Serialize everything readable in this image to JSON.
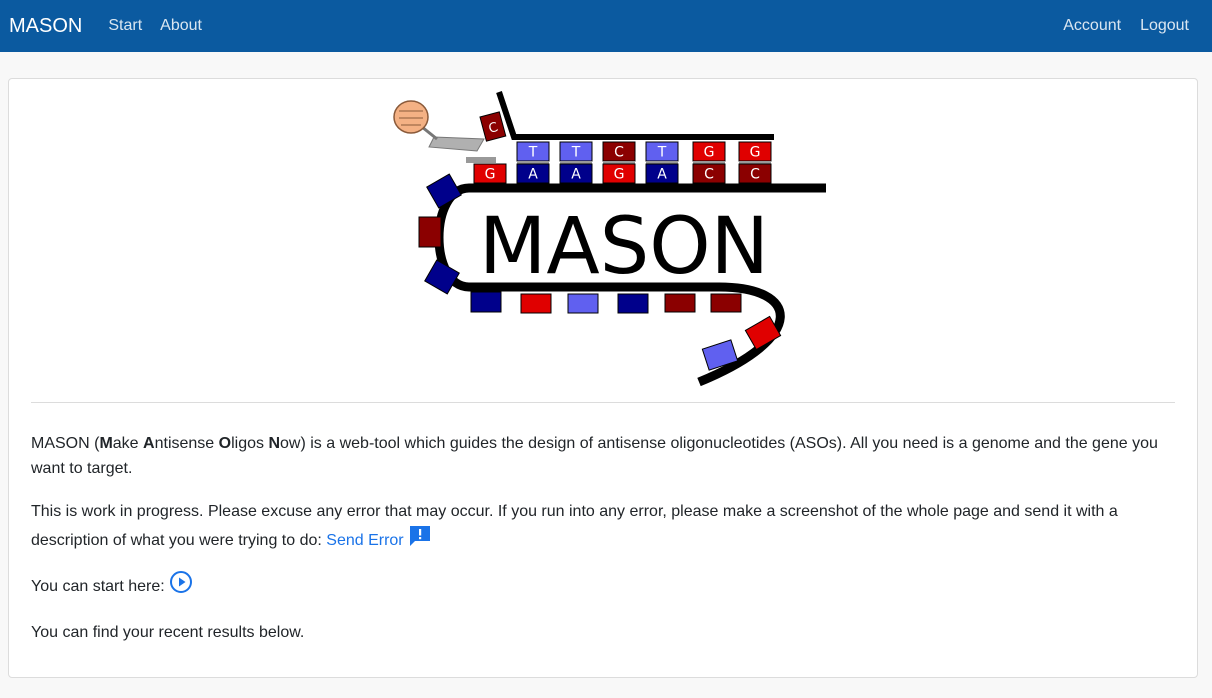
{
  "navbar": {
    "brand": "MASON",
    "left_links": [
      "Start",
      "About"
    ],
    "right_links": [
      "Account",
      "Logout"
    ],
    "color": "#0b5aa0"
  },
  "logo": {
    "title": "MASON",
    "top_strand": [
      "T",
      "T",
      "C",
      "T",
      "G",
      "G"
    ],
    "bottom_strand": [
      "G",
      "A",
      "A",
      "G",
      "A",
      "C",
      "C"
    ],
    "hook_letter": "C"
  },
  "intro": {
    "acronym_parts": [
      {
        "text": "MASON (",
        "bold": false
      },
      {
        "text": "M",
        "bold": true
      },
      {
        "text": "ake ",
        "bold": false
      },
      {
        "text": "A",
        "bold": true
      },
      {
        "text": "ntisense ",
        "bold": false
      },
      {
        "text": "O",
        "bold": true
      },
      {
        "text": "ligos ",
        "bold": false
      },
      {
        "text": "N",
        "bold": true
      },
      {
        "text": "ow) is a web-tool which guides the design of antisense oligonucleotides (ASOs). All you need is a genome and the gene you want to target.",
        "bold": false
      }
    ],
    "wip_text": "This is work in progress. Please excuse any error that may occur. If you run into any error, please make a screenshot of the whole page and send it with a description of what you were trying to do: ",
    "send_error_label": "Send Error",
    "start_text": "You can start here: ",
    "recent_text": "You can find your recent results below."
  }
}
